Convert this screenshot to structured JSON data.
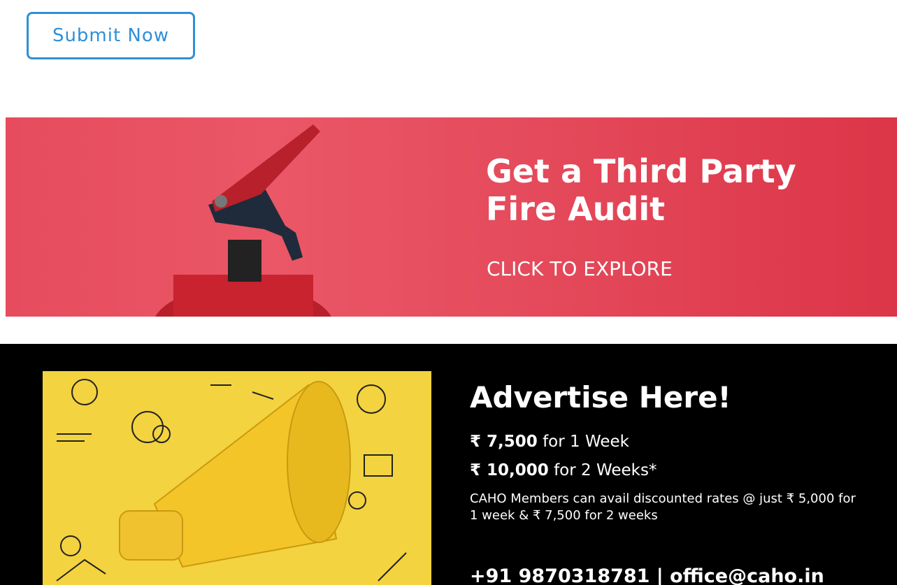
{
  "submit_button": {
    "label": "Submit Now"
  },
  "fire_banner": {
    "title_line1": "Get a Third Party",
    "title_line2": "Fire Audit",
    "cta": "CLICK TO EXPLORE",
    "colors": {
      "background": "#e64c5d",
      "text": "#ffffff"
    }
  },
  "ad_banner": {
    "title": "Advertise Here!",
    "price1": {
      "amount": "₹ 7,500",
      "label": " for 1 Week"
    },
    "price2": {
      "amount": "₹ 10,000",
      "label": " for 2 Weeks*"
    },
    "member_note": "CAHO Members can avail discounted rates @ just ₹ 5,000 for 1 week & ₹ 7,500 for 2 weeks",
    "contact": "+91 9870318781  | office@caho.in",
    "colors": {
      "background": "#000000",
      "image_bg": "#f3d33f",
      "megaphone": "#f4c528"
    }
  },
  "accent_color": "#2f8fd8"
}
